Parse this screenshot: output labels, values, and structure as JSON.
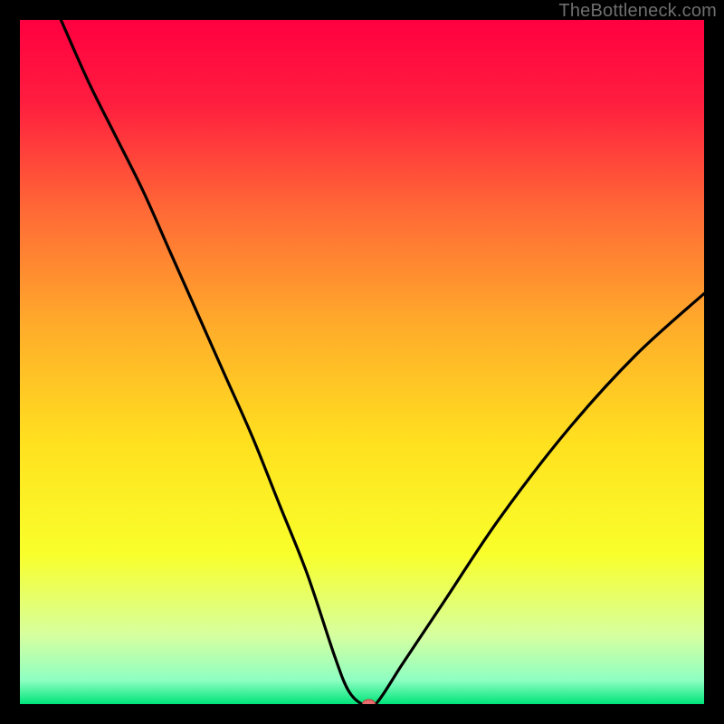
{
  "watermark": {
    "text": "TheBottleneck.com"
  },
  "chart_data": {
    "type": "line",
    "title": "",
    "xlabel": "",
    "ylabel": "",
    "xlim": [
      0,
      100
    ],
    "ylim": [
      0,
      100
    ],
    "grid": false,
    "legend": false,
    "background": {
      "type": "vertical-gradient",
      "stops": [
        {
          "pos": 0.0,
          "color": "#ff0040"
        },
        {
          "pos": 0.12,
          "color": "#ff1d3f"
        },
        {
          "pos": 0.28,
          "color": "#ff6a36"
        },
        {
          "pos": 0.45,
          "color": "#ffad2a"
        },
        {
          "pos": 0.62,
          "color": "#ffe11f"
        },
        {
          "pos": 0.78,
          "color": "#f9ff2a"
        },
        {
          "pos": 0.9,
          "color": "#d6ffa0"
        },
        {
          "pos": 0.965,
          "color": "#8effc2"
        },
        {
          "pos": 1.0,
          "color": "#00e47a"
        }
      ]
    },
    "series": [
      {
        "name": "bottleneck-curve",
        "color": "#000000",
        "x": [
          6,
          10,
          14,
          18,
          22,
          26,
          30,
          34,
          38,
          42,
          46,
          48,
          50,
          52,
          56,
          62,
          70,
          80,
          90,
          100
        ],
        "y": [
          100,
          91,
          83,
          75,
          66,
          57,
          48,
          39,
          29,
          19,
          7,
          2,
          0,
          0,
          6,
          15,
          27,
          40,
          51,
          60
        ]
      }
    ],
    "marker": {
      "name": "min-point",
      "x": 51,
      "y": 0,
      "rx": 7,
      "ry": 5,
      "fill": "#e76f6f",
      "stroke": "#c43b3b"
    }
  }
}
